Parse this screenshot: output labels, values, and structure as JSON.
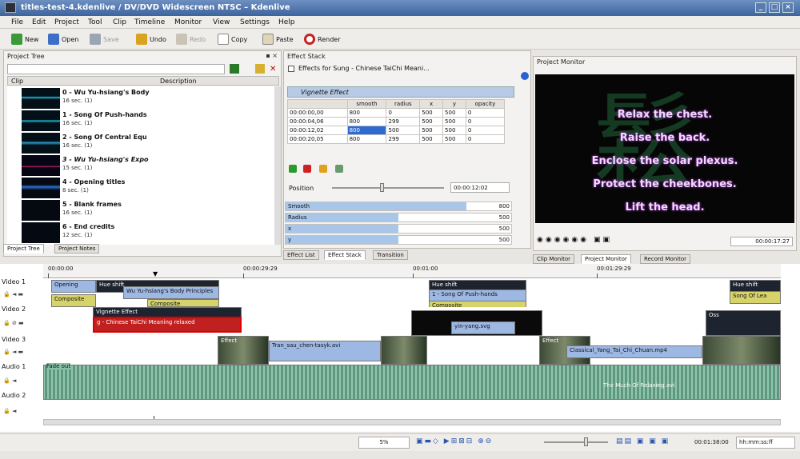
{
  "window": {
    "title": "titles-test-4.kdenlive / DV/DVD Widescreen NTSC – Kdenlive"
  },
  "menu": [
    "File",
    "Edit",
    "Project",
    "Tool",
    "Clip",
    "Timeline",
    "Monitor",
    "View",
    "Settings",
    "Help"
  ],
  "toolbar": {
    "new": "New",
    "open": "Open",
    "save": "Save",
    "undo": "Undo",
    "redo": "Redo",
    "copy": "Copy",
    "paste": "Paste",
    "render": "Render"
  },
  "project_tree": {
    "title": "Project Tree",
    "col_clip": "Clip",
    "col_desc": "Description",
    "clips": [
      {
        "name": "0 - Wu Yu-hsiang's Body",
        "dur": "16 sec. (1)"
      },
      {
        "name": "1 - Song Of Push-hands",
        "dur": "16 sec. (1)"
      },
      {
        "name": "2 - Song Of Central Equ",
        "dur": "16 sec. (1)"
      },
      {
        "name": "3 - Wu Yu-hsiang's Expo",
        "dur": "15 sec. (1)"
      },
      {
        "name": "4 - Opening titles",
        "dur": "8 sec. (1)"
      },
      {
        "name": "5 - Blank frames",
        "dur": "16 sec. (1)"
      },
      {
        "name": "6 - End credits",
        "dur": "12 sec. (1)"
      }
    ],
    "tabs": [
      "Project Tree",
      "Project Notes"
    ]
  },
  "effect_stack": {
    "title": "Effect Stack",
    "effects_for": "Effects for Sung - Chinese TaiChi Meani...",
    "effect_name": "Vignette Effect",
    "headers": [
      "",
      "smooth",
      "radius",
      "x",
      "y",
      "opacity"
    ],
    "rows": [
      [
        "00:00:00,00",
        "800",
        "0",
        "500",
        "500",
        "0"
      ],
      [
        "00:00:04,06",
        "800",
        "299",
        "500",
        "500",
        "0"
      ],
      [
        "00:00:12,02",
        "800",
        "500",
        "500",
        "500",
        "0"
      ],
      [
        "00:00:20,05",
        "800",
        "299",
        "500",
        "500",
        "0"
      ]
    ],
    "position_label": "Position",
    "position_value": "00:00:12:02",
    "params": [
      {
        "label": "Smooth",
        "value": "800",
        "fill": 0.8
      },
      {
        "label": "Radius",
        "value": "500",
        "fill": 0.5
      },
      {
        "label": "x",
        "value": "500",
        "fill": 0.5
      },
      {
        "label": "y",
        "value": "500",
        "fill": 0.5
      }
    ],
    "tabs": [
      "Effect List",
      "Effect Stack",
      "Transition"
    ]
  },
  "monitor": {
    "title": "Project Monitor",
    "lines": [
      "Relax the chest.",
      "Raise the back.",
      "Enclose the solar plexus.",
      "Protect the cheekbones.",
      "Lift the head."
    ],
    "timecode": "00:00:17:27",
    "tabs": [
      "Clip Monitor",
      "Project Monitor",
      "Record Monitor"
    ]
  },
  "timeline": {
    "ruler": [
      "00:00:00",
      "00:00:29:29",
      "00:01:00",
      "00:01:29:29"
    ],
    "tracks": [
      "Video 1",
      "Video 2",
      "Video 3",
      "Audio 1",
      "Audio 2"
    ],
    "clips": {
      "v1": [
        "Opening",
        "Hue shift",
        "Wu Yu-hsiang's Body Principles",
        "Composite",
        "Hue shift",
        "1 - Song Of Push-hands",
        "Composite",
        "Hue shift",
        "Song Of Lea"
      ],
      "v1b": [
        "Composite"
      ],
      "v2": [
        "Vignette Effect",
        "g - Chinese TaiChi Meaning relaxed",
        "yin-yang.svg",
        "Oss"
      ],
      "v3": [
        "Effect",
        "Tran_sau_chen-tasyk.avi",
        "Effect",
        "Classical_Yang_Tai_Chi_Chuan.mp4"
      ],
      "a1": [
        "Fade out",
        "The Much Of Relaxing.avi"
      ]
    }
  },
  "status": {
    "zoom": "5%",
    "timecode": "00:01:38:00",
    "fps": "hh:mm:ss:ff"
  }
}
